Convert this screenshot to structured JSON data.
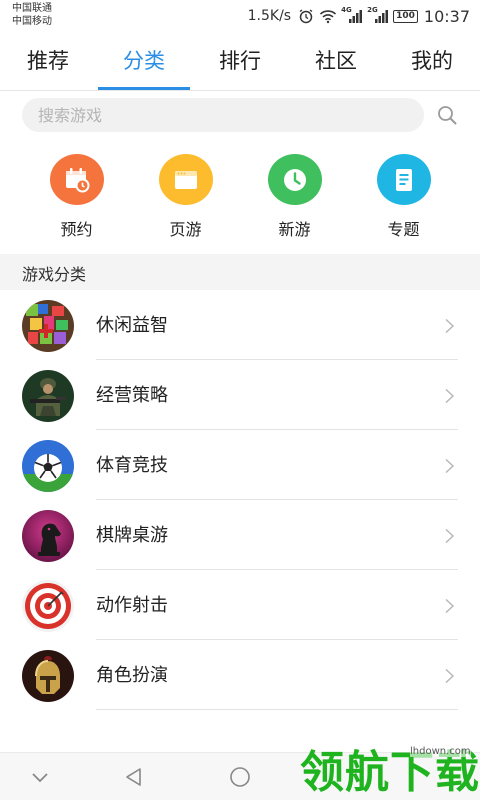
{
  "status_bar": {
    "carrier_1": "中国联通",
    "carrier_2": "中国移动",
    "net_speed": "1.5K/s",
    "signal_1_type": "4G",
    "signal_2_type": "2G",
    "battery": "100",
    "time": "10:37"
  },
  "tabs": [
    {
      "label": "推荐",
      "active": false
    },
    {
      "label": "分类",
      "active": true
    },
    {
      "label": "排行",
      "active": false
    },
    {
      "label": "社区",
      "active": false
    },
    {
      "label": "我的",
      "active": false
    }
  ],
  "search": {
    "placeholder": "搜索游戏",
    "icon": "search-icon"
  },
  "quick_entries": [
    {
      "label": "预约",
      "icon": "calendar-clock-icon",
      "color": "#f5743d"
    },
    {
      "label": "页游",
      "icon": "browser-window-icon",
      "color": "#fcbc2d"
    },
    {
      "label": "新游",
      "icon": "clock-icon",
      "color": "#3fbf5d"
    },
    {
      "label": "专题",
      "icon": "document-icon",
      "color": "#1fb6e3"
    }
  ],
  "section": {
    "title": "游戏分类"
  },
  "categories": [
    {
      "label": "休闲益智",
      "icon": "puzzle-blocks-icon"
    },
    {
      "label": "经营策略",
      "icon": "soldier-icon"
    },
    {
      "label": "体育竞技",
      "icon": "soccer-ball-icon"
    },
    {
      "label": "棋牌桌游",
      "icon": "chess-knight-icon"
    },
    {
      "label": "动作射击",
      "icon": "target-icon"
    },
    {
      "label": "角色扮演",
      "icon": "helmet-icon"
    }
  ],
  "watermark": {
    "text": "领航下载",
    "url": "lhdown.com"
  },
  "colors": {
    "accent": "#2b8ee6",
    "watermark": "#1fb41f"
  }
}
